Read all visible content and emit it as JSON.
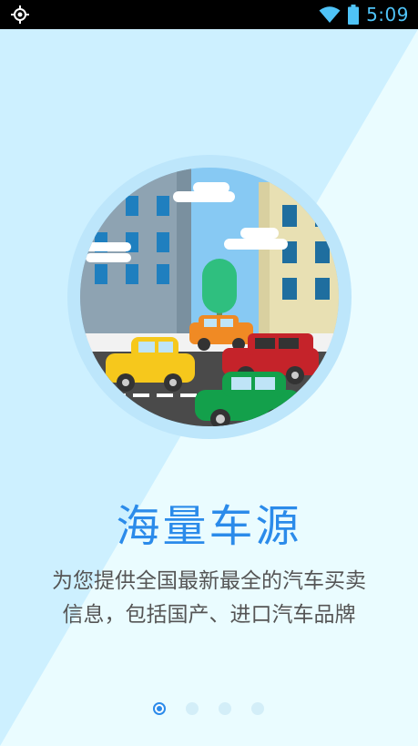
{
  "status_bar": {
    "time": "5:09",
    "left_icon": "location-target-icon",
    "wifi_icon": "wifi-icon",
    "battery_icon": "battery-icon"
  },
  "illustration": {
    "subject": "city-street-cars-icon"
  },
  "intro": {
    "title": "海量车源",
    "description_line1": "为您提供全国最新最全的汽车买卖",
    "description_line2": "信息，包括国产、进口汽车品牌"
  },
  "pager": {
    "total": 4,
    "active_index": 0
  },
  "colors": {
    "accent": "#2b8bea",
    "background_light": "#eafcff",
    "background_blue": "#cdf0ff"
  }
}
